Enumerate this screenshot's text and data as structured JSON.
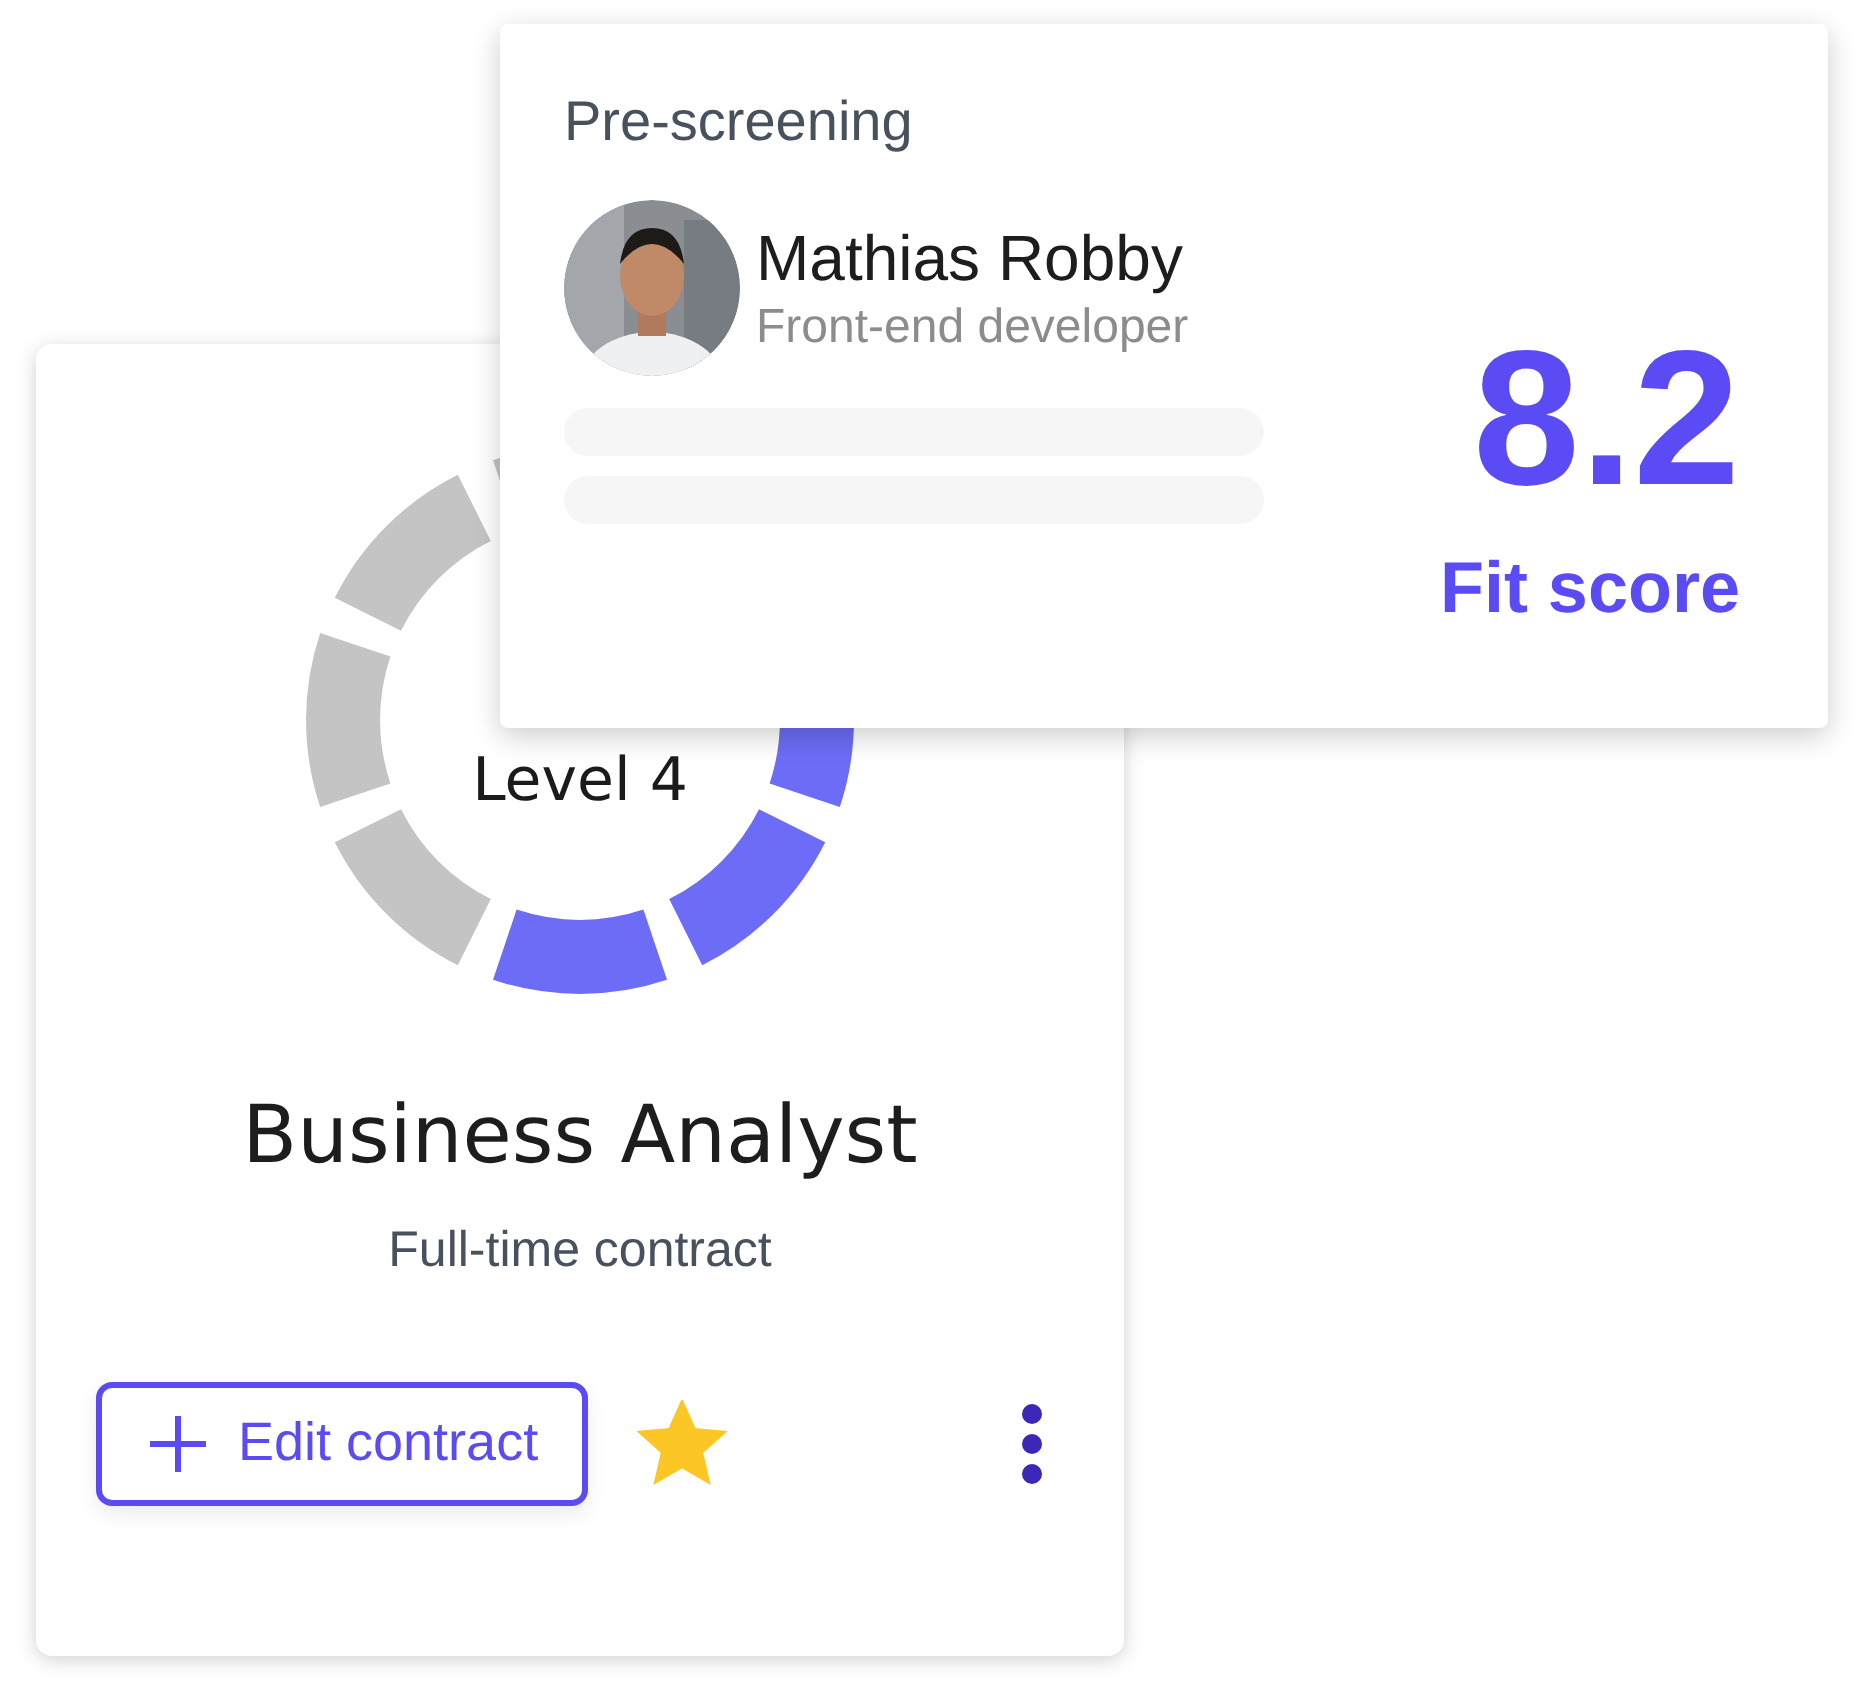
{
  "job_card": {
    "level_ring": {
      "level": 0.5
    },
    "level_label": "Level 4",
    "title": "Business Analyst",
    "subtitle": "Full-time contract",
    "edit_button": {
      "label": "Edit contract"
    },
    "favorite": {
      "on": true
    }
  },
  "prescreening_card": {
    "heading": "Pre-screening",
    "candidate": {
      "name": "Mathias Robby",
      "role": "Front-end developer"
    },
    "score": "8.2",
    "score_label": "Fit score"
  }
}
